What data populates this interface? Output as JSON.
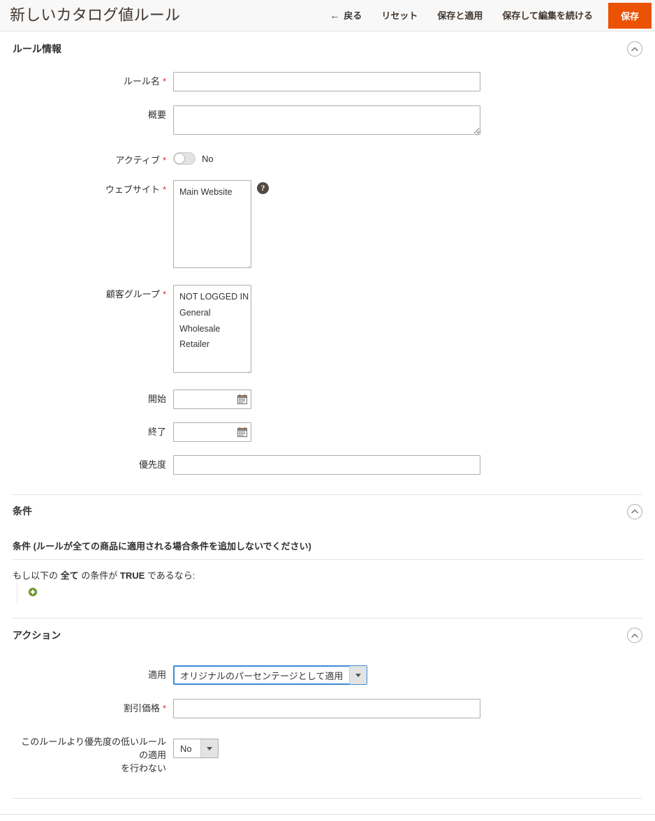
{
  "header": {
    "title": "新しいカタログ値ルール",
    "back_label": "戻る",
    "back_icon": "arrow-left-icon",
    "reset_label": "リセット",
    "save_apply_label": "保存と適用",
    "save_continue_label": "保存して編集を続ける",
    "save_label": "保存",
    "accent_color": "#eb5202",
    "bg_color": "#f8f8f8"
  },
  "rule_info": {
    "section_title": "ルール情報",
    "collapse_icon": "chevron-up-circle-icon",
    "rule_name": {
      "label": "ルール名",
      "required": "*",
      "value": "",
      "placeholder": ""
    },
    "description": {
      "label": "概要",
      "value": "",
      "placeholder": ""
    },
    "active": {
      "label": "アクティブ",
      "required": "*",
      "state_label": "No",
      "checked": false
    },
    "website": {
      "label": "ウェブサイト",
      "required": "*",
      "help_icon": "question-mark-icon",
      "options": [
        "Main Website"
      ],
      "selected": []
    },
    "customer_groups": {
      "label": "顧客グループ",
      "required": "*",
      "options": [
        "NOT LOGGED IN",
        "General",
        "Wholesale",
        "Retailer"
      ],
      "selected": []
    },
    "from_date": {
      "label": "開始",
      "value": "",
      "icon": "calendar-icon"
    },
    "to_date": {
      "label": "終了",
      "value": "",
      "icon": "calendar-icon"
    },
    "priority": {
      "label": "優先度",
      "value": ""
    }
  },
  "conditions": {
    "section_title": "条件",
    "collapse_icon": "chevron-up-circle-icon",
    "subheading": "条件 (ルールが全ての商品に適用される場合条件を追加しないでください)",
    "intro_prefix": "もし以下の",
    "intro_aggregator": "全て",
    "intro_middle": "の条件が",
    "intro_value": "TRUE",
    "intro_suffix": "であるなら:",
    "add_icon": "add-condition-icon"
  },
  "actions": {
    "section_title": "アクション",
    "collapse_icon": "chevron-up-circle-icon",
    "apply": {
      "label": "適用",
      "selected": "オリジナルのパーセンテージとして適用",
      "arrow_icon": "chevron-down-icon",
      "focused": true
    },
    "discount_amount": {
      "label": "割引価格",
      "required": "*",
      "value": ""
    },
    "discard_subsequent": {
      "label_line1": "このルールより優先度の低いルールの適用",
      "label_line2": "を行わない",
      "selected": "No",
      "arrow_icon": "chevron-down-icon"
    }
  }
}
